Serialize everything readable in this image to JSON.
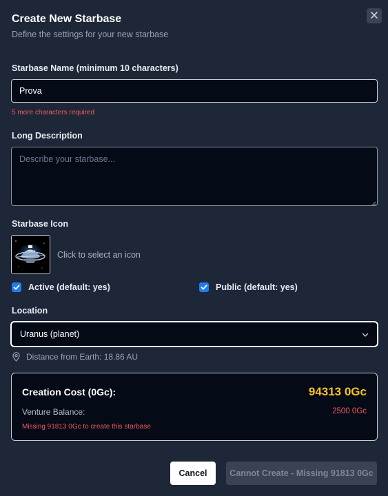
{
  "dialog": {
    "title": "Create New Starbase",
    "subtitle": "Define the settings for your new starbase",
    "close_icon": "close-icon"
  },
  "name_field": {
    "label": "Starbase Name (minimum 10 characters)",
    "value": "Prova",
    "error": "5 more characters required"
  },
  "description_field": {
    "label": "Long Description",
    "value": "",
    "placeholder": "Describe your starbase..."
  },
  "icon_field": {
    "label": "Starbase Icon",
    "hint": "Click to select an icon",
    "icon": "starbase-icon"
  },
  "options": {
    "active": {
      "label": "Active (default: yes)",
      "checked": true
    },
    "public": {
      "label": "Public (default: yes)",
      "checked": true
    }
  },
  "location": {
    "label": "Location",
    "selected": "Uranus (planet)",
    "distance": "Distance from Earth: 18.86 AU",
    "distance_icon": "map-pin-icon",
    "chevron_icon": "chevron-down-icon"
  },
  "cost": {
    "title": "Creation Cost (0Gc):",
    "value": "94313 0Gc",
    "balance_label": "Venture Balance:",
    "balance_value": "2500 0Gc",
    "missing": "Missing 91813 0Gc to create this starbase"
  },
  "actions": {
    "cancel_label": "Cancel",
    "create_label": "Cannot Create - Missing 91813 0Gc"
  },
  "colors": {
    "background": "#1e2738",
    "input_bg": "#050a17",
    "accent_gold": "#f5c518",
    "error_red": "#f05a5a",
    "checkbox_blue": "#1f7cf0"
  }
}
